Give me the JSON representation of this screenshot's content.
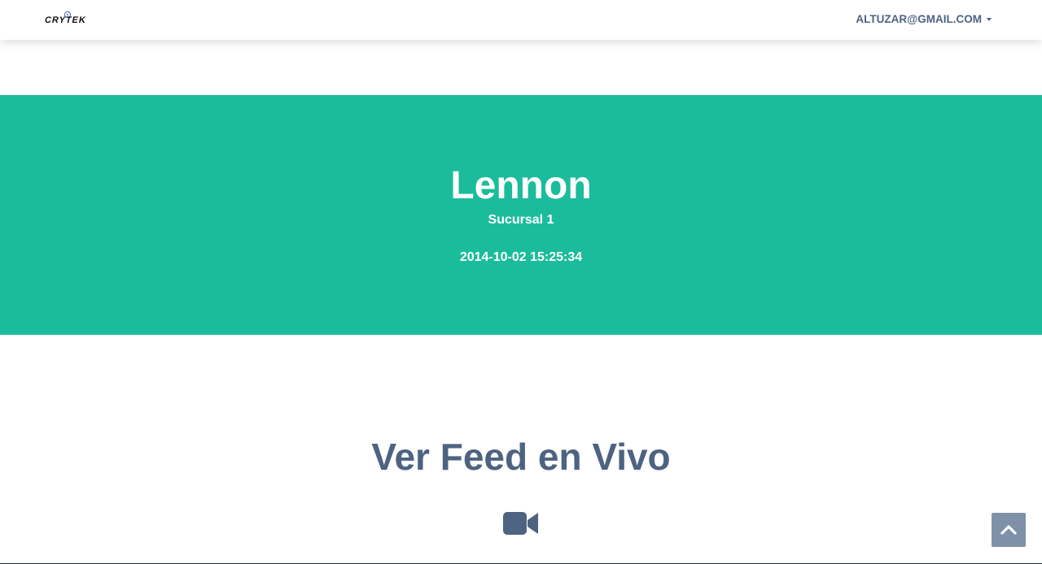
{
  "navbar": {
    "logo_text": "CRYTEK",
    "user_email": "ALTUZAR@GMAIL.COM"
  },
  "hero": {
    "title": "Lennon",
    "subtitle": "Sucursal 1",
    "timestamp": "2014-10-02 15:25:34",
    "background_color": "#1bbc9b"
  },
  "feed": {
    "title": "Ver Feed en Vivo",
    "icon": "video-camera-icon"
  },
  "scroll_top": {
    "icon": "chevron-up-icon"
  },
  "colors": {
    "accent": "#1bbc9b",
    "text_primary": "#4d6381",
    "scroll_button": "#7f91a8"
  }
}
